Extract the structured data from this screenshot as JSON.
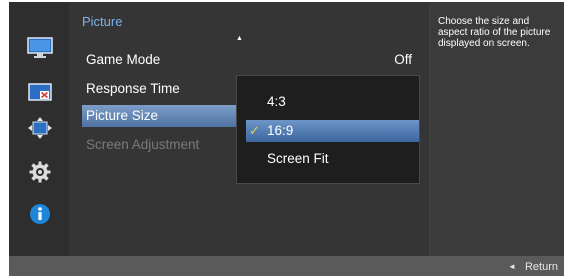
{
  "colors": {
    "accent": "#7fb1ea",
    "selection": "#4e72a3",
    "check": "#e6d54a",
    "info_icon": "#1f86d9"
  },
  "sidebar": {
    "icons": [
      "picture-icon",
      "onscreen-display-icon",
      "position-arrows-icon",
      "system-gear-icon",
      "information-icon"
    ]
  },
  "menu": {
    "title": "Picture",
    "items": [
      {
        "label": "Game Mode",
        "value": "Off"
      },
      {
        "label": "Response Time",
        "value": ""
      },
      {
        "label": "Picture Size",
        "value": ""
      },
      {
        "label": "Screen Adjustment",
        "value": ""
      }
    ]
  },
  "dropdown": {
    "options": [
      "4:3",
      "16:9",
      "Screen Fit"
    ],
    "selected": "16:9"
  },
  "help": {
    "text": "Choose the size and aspect ratio of the picture displayed on screen."
  },
  "footer": {
    "return_label": "Return"
  }
}
